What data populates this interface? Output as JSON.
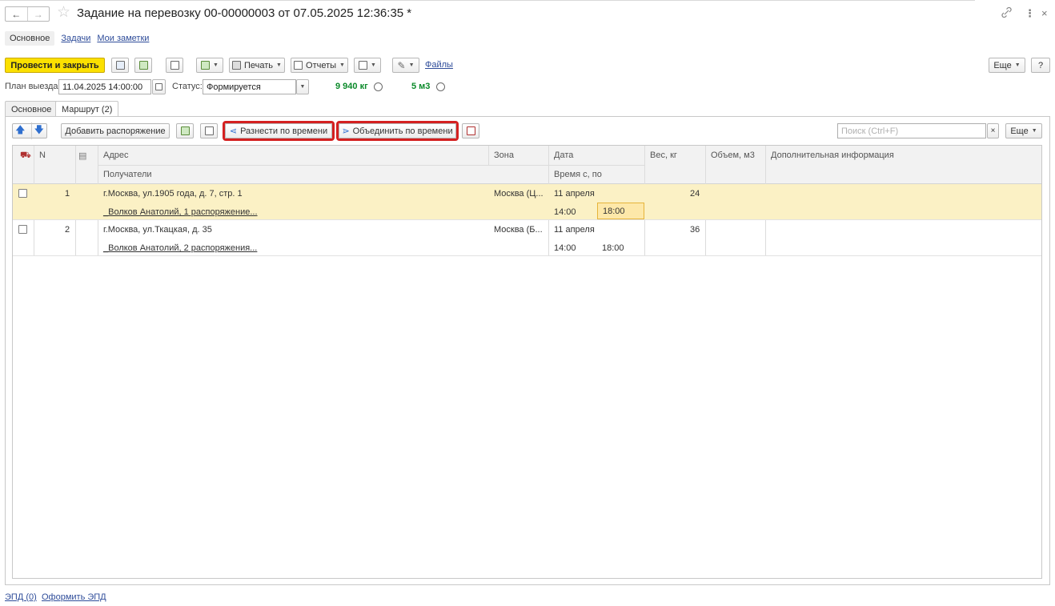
{
  "window": {
    "title": "Задание на перевозку 00-00000003 от 07.05.2025 12:36:35 *",
    "back_glyph": "←",
    "forward_glyph": "→",
    "star_glyph": "☆",
    "link_glyph": "⊘",
    "menu_glyph": "⋮",
    "close_glyph": "×"
  },
  "sections": {
    "main": "Основное",
    "tasks": "Задачи",
    "notes": "Мои заметки"
  },
  "toolbar": {
    "post_close": "Провести и закрыть",
    "print": "Печать",
    "reports": "Отчеты",
    "files": "Файлы",
    "more": "Еще",
    "help": "?"
  },
  "fields": {
    "plan_label": "План выезда:",
    "plan_value": "11.04.2025 14:00:00",
    "status_label": "Статус:",
    "status_value": "Формируется",
    "weight_total": "9 940 кг",
    "volume_total": "5 м3"
  },
  "tabs": {
    "main": "Основное",
    "route": "Маршрут (2)"
  },
  "route_toolbar": {
    "add_order": "Добавить распоряжение",
    "split_by_time": "Разнести по времени",
    "merge_by_time": "Объединить по времени",
    "search_placeholder": "Поиск (Ctrl+F)",
    "clear": "×",
    "more": "Еще"
  },
  "table": {
    "headers": {
      "n": "N",
      "address": "Адрес",
      "recipients": "Получатели",
      "zone": "Зона",
      "date": "Дата",
      "time": "Время с, по",
      "weight": "Вес, кг",
      "volume": "Объем, м3",
      "info": "Дополнительная информация"
    },
    "rows": [
      {
        "n": "1",
        "address": "г.Москва, ул.1905 года, д. 7, стр. 1",
        "recipients": "_Волков Анатолий, 1 распоряжение...",
        "zone": "Москва (Ц...",
        "date": "11 апреля",
        "time_from": "14:00",
        "time_to": "18:00",
        "weight": "24",
        "volume": "",
        "info": ""
      },
      {
        "n": "2",
        "address": "г.Москва, ул.Ткацкая, д. 35",
        "recipients": "_Волков Анатолий, 2 распоряжения...",
        "zone": "Москва (Б...",
        "date": "11 апреля",
        "time_from": "14:00",
        "time_to": "18:00",
        "weight": "36",
        "volume": "",
        "info": ""
      }
    ]
  },
  "footer": {
    "epd": "ЭПД (0)",
    "make_epd": "Оформить ЭПД"
  },
  "colors": {
    "primary_button": "#fbe000",
    "selected_row": "#fbf1c5",
    "highlight_border": "#d42020",
    "stat_green": "#0b8a2a",
    "link_blue": "#2f4d9a"
  }
}
